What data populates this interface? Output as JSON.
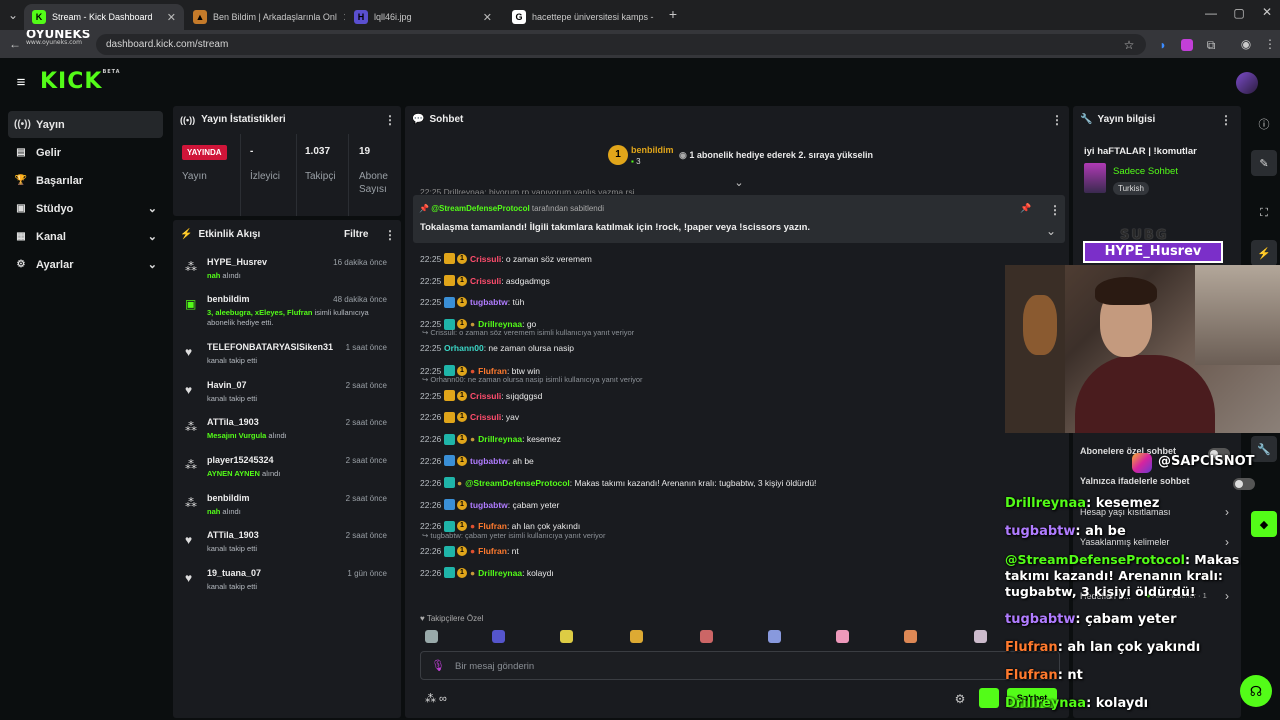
{
  "browser": {
    "tabs": [
      {
        "title": "Stream - Kick Dashboard",
        "active": true
      },
      {
        "title": "Ben Bildim | Arkadaşlarınla Onl",
        "active": false
      },
      {
        "title": "lqll46i.jpg",
        "active": false
      },
      {
        "title": "hacettepe üniversitesi kamps -",
        "active": false
      }
    ],
    "url": "dashboard.kick.com/stream",
    "watermark": "OYUNEKS",
    "watermark_sub": "www.oyuneks.com"
  },
  "header": {
    "logo": "KICK",
    "logo_tag": "BETA"
  },
  "sidebar": {
    "items": [
      {
        "label": "Yayın",
        "icon": "broadcast-icon",
        "glyph": "((•))",
        "chevron": false
      },
      {
        "label": "Gelir",
        "icon": "wallet-icon",
        "glyph": "▤",
        "chevron": false
      },
      {
        "label": "Başarılar",
        "icon": "trophy-icon",
        "glyph": "🏆",
        "chevron": false
      },
      {
        "label": "Stüdyo",
        "icon": "studio-icon",
        "glyph": "▣",
        "chevron": true
      },
      {
        "label": "Kanal",
        "icon": "channel-icon",
        "glyph": "▦",
        "chevron": true
      },
      {
        "label": "Ayarlar",
        "icon": "gear-icon",
        "glyph": "⚙",
        "chevron": true
      }
    ]
  },
  "stats": {
    "title": "Yayın İstatistikleri",
    "live_badge": "YAYINDA",
    "live_label": "Yayın",
    "viewers_value": "-",
    "viewers_label": "İzleyici",
    "followers_value": "1.037",
    "followers_label": "Takipçi",
    "subs_value": "19",
    "subs_label": "Abone Sayısı"
  },
  "activity": {
    "title": "Etkinlik Akışı",
    "filter": "Filtre",
    "items": [
      {
        "name": "HYPE_Husrev",
        "time": "16 dakika önce",
        "hl": "nah",
        "desc": " alındı"
      },
      {
        "name": "benbildim",
        "time": "48 dakika önce",
        "hl": "3, aleebugra, xEleyes, Flufran",
        "desc": " isimli kullanıcıya abonelik hediye etti."
      },
      {
        "name": "TELEFONBATARYASISiken31",
        "time": "1 saat önce",
        "hl": "",
        "desc": "kanalı takip etti"
      },
      {
        "name": "Havin_07",
        "time": "2 saat önce",
        "hl": "",
        "desc": "kanalı takip etti"
      },
      {
        "name": "ATTila_1903",
        "time": "2 saat önce",
        "hl": "Mesajını Vurgula",
        "desc": " alındı"
      },
      {
        "name": "player15245324",
        "time": "2 saat önce",
        "hl": "AYNEN AYNEN",
        "desc": " alındı"
      },
      {
        "name": "benbildim",
        "time": "2 saat önce",
        "hl": "nah",
        "desc": " alındı"
      },
      {
        "name": "ATTila_1903",
        "time": "2 saat önce",
        "hl": "",
        "desc": "kanalı takip etti"
      },
      {
        "name": "19_tuana_07",
        "time": "1 gün önce",
        "hl": "",
        "desc": "kanalı takip etti"
      }
    ]
  },
  "chat": {
    "title": "Sohbet",
    "top_gifter": "benbildim",
    "top_gifter_count": "3",
    "gift_promo": "1 abonelik hediye ederek 2. sıraya yükselin",
    "pinned_by": "@StreamDefenseProtocol",
    "pinned_suffix": " tarafından sabitlendi",
    "pinned_text": "Tokalaşma tamamlandı! İlgili takımlara katılmak için !rock, !paper veya !scissors yazın.",
    "partial_line": "22:25  Drillreynaa: biyorum rp yapıyorum yanlış yazma rsi",
    "messages": [
      {
        "time": "22:25",
        "user": "Crissuli",
        "color": "#ff4d6d",
        "text": ": o zaman söz veremem"
      },
      {
        "time": "22:25",
        "user": "Crissuli",
        "color": "#ff4d6d",
        "text": ": asdgadmgs"
      },
      {
        "time": "22:25",
        "user": "tugbabtw",
        "color": "#b07cff",
        "text": ": tüh"
      },
      {
        "time": "22:25",
        "user": "Drillreynaa",
        "color": "#53fc18",
        "text": ": go"
      },
      {
        "time": "22:25",
        "user": "Orhann00",
        "color": "#3bd6c6",
        "text": ": ne zaman olursa nasip",
        "reply": "Crissuli: o zaman söz veremem isimli kullanıcıya yanıt veriyor"
      },
      {
        "time": "22:25",
        "user": "Flufran",
        "color": "#ff7a2e",
        "text": ": btw win"
      },
      {
        "time": "22:25",
        "user": "Crissuli",
        "color": "#ff4d6d",
        "text": ": sıjqdggsd",
        "reply": "Orhann00: ne zaman olursa nasip isimli kullanıcıya yanıt veriyor"
      },
      {
        "time": "22:26",
        "user": "Crissuli",
        "color": "#ff4d6d",
        "text": ": yav"
      },
      {
        "time": "22:26",
        "user": "Drillreynaa",
        "color": "#53fc18",
        "text": ": kesemez"
      },
      {
        "time": "22:26",
        "user": "tugbabtw",
        "color": "#b07cff",
        "text": ": ah be"
      },
      {
        "time": "22:26",
        "user": "@StreamDefenseProtocol",
        "color": "#53fc18",
        "text": ": Makas takımı kazandı! Arenanın kralı: tugbabtw, 3 kişiyi öldürdü!"
      },
      {
        "time": "22:26",
        "user": "tugbabtw",
        "color": "#b07cff",
        "text": ": çabam yeter"
      },
      {
        "time": "22:26",
        "user": "Flufran",
        "color": "#ff7a2e",
        "text": ": ah lan çok yakındı"
      },
      {
        "time": "22:26",
        "user": "Flufran",
        "color": "#ff7a2e",
        "text": ": nt",
        "reply": "tugbabtw: çabam yeter isimli kullanıcıya yanıt veriyor"
      },
      {
        "time": "22:26",
        "user": "Drillreynaa",
        "color": "#53fc18",
        "text": ": kolaydı"
      }
    ],
    "followers_only": "Takipçilere Özel",
    "input_placeholder": "Bir mesaj gönderin",
    "send_label": "Sohbet"
  },
  "info": {
    "title": "Yayın bilgisi",
    "stream_title": "iyi haFTALAR | !komutlar",
    "category": "Sadece Sohbet",
    "language": "Turkish",
    "sub_chat": "Abonelere özel sohbet",
    "emote_chat": "Yalnızca ifadelerle sohbet",
    "restrictions": "Hesap yaşı kısıtlaması",
    "banned": "Yasaklanmış kelimeler",
    "goals": "Hedefleri b...",
    "goals_active": "Aktif hedefler · 1"
  },
  "overlay": {
    "subg": "SUBG",
    "hype": "HYPE_Husrev",
    "instagram": "@SAPCISNOT",
    "lines": [
      {
        "user": "Drillreynaa",
        "color": "#53fc18",
        "text": ": kesemez"
      },
      {
        "user": "tugbabtw",
        "color": "#b07cff",
        "text": ": ah be"
      },
      {
        "user": "@StreamDefenseProtocol",
        "color": "#53fc18",
        "text": ": Makas takımı kazandı! Arenanın kralı: tugbabtw, 3 kişiyi öldürdü!"
      },
      {
        "user": "tugbabtw",
        "color": "#b07cff",
        "text": ": çabam yeter"
      },
      {
        "user": "Flufran",
        "color": "#ff7a2e",
        "text": ": ah lan çok yakındı"
      },
      {
        "user": "Flufran",
        "color": "#ff7a2e",
        "text": ": nt"
      },
      {
        "user": "Drillreynaa",
        "color": "#53fc18",
        "text": ": kolaydı"
      }
    ]
  }
}
